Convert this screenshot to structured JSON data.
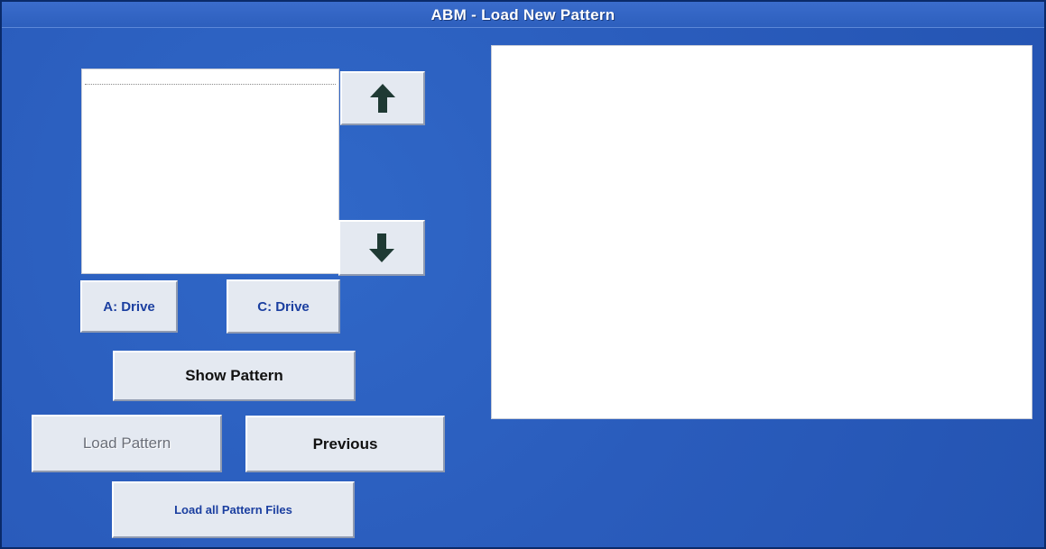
{
  "window": {
    "title": "ABM - Load New Pattern"
  },
  "file_list": {
    "items": [
      ""
    ]
  },
  "icons": {
    "scroll_up": "arrow-up-icon",
    "scroll_down": "arrow-down-icon"
  },
  "buttons": {
    "a_drive": "A: Drive",
    "c_drive": "C: Drive",
    "show_pattern": "Show Pattern",
    "load_pattern": "Load Pattern",
    "previous": "Previous",
    "load_all": "Load all Pattern Files"
  },
  "colors": {
    "window_background": "#2a5fc0",
    "button_face": "#e4e9f1",
    "button_text_blue": "#1b3fa0",
    "arrow_icon": "#1f3a34"
  }
}
